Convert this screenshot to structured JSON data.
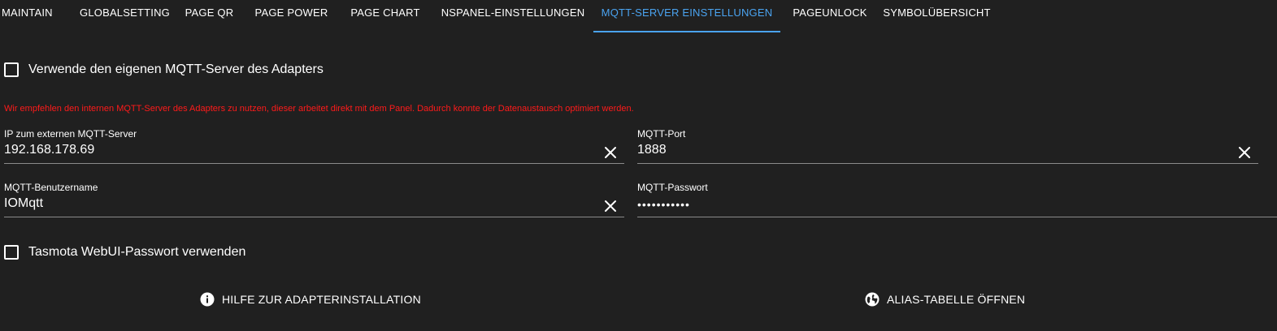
{
  "tabs": [
    {
      "label": "MAINTAIN"
    },
    {
      "label": "GLOBALSETTING"
    },
    {
      "label": "PAGE QR"
    },
    {
      "label": "PAGE POWER"
    },
    {
      "label": "PAGE CHART"
    },
    {
      "label": "NSPANEL-EINSTELLUNGEN"
    },
    {
      "label": "MQTT-SERVER EINSTELLUNGEN",
      "active": true
    },
    {
      "label": "PAGEUNLOCK"
    },
    {
      "label": "SYMBOLÜBERSICHT"
    }
  ],
  "settings": {
    "use_internal_mqtt_label": "Verwende den eigenen MQTT-Server des Adapters",
    "hint": "Wir empfehlen den internen MQTT-Server des Adapters zu nutzen, dieser arbeitet direkt mit dem Panel. Dadurch konnte der Datenaustausch optimiert werden.",
    "ip": {
      "label": "IP zum externen MQTT-Server",
      "value": "192.168.178.69"
    },
    "port": {
      "label": "MQTT-Port",
      "value": "1888"
    },
    "username": {
      "label": "MQTT-Benutzername",
      "value": "IOMqtt"
    },
    "password": {
      "label": "MQTT-Passwort",
      "value": "•••••••••••"
    },
    "tasmota_pw_label": "Tasmota WebUI-Passwort verwenden"
  },
  "actions": {
    "help_label": "HILFE ZUR ADAPTERINSTALLATION",
    "alias_label": "ALIAS-TABELLE ÖFFNEN"
  },
  "colors": {
    "background": "#202020",
    "accent": "#4aa3f0",
    "hint": "#ff1a1a"
  },
  "icons": {
    "help": "info-icon",
    "alias": "globe-icon",
    "clear": "close-icon"
  }
}
